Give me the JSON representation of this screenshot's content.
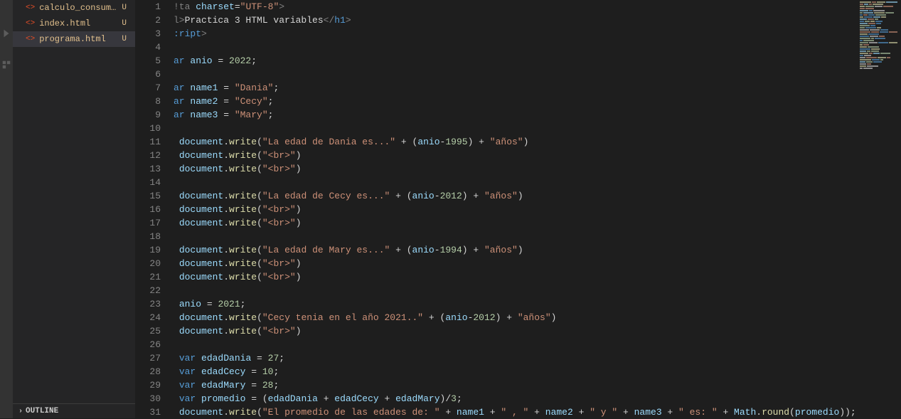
{
  "sidebar": {
    "files": [
      {
        "name": "calculo_consum…",
        "status": "U",
        "active": false
      },
      {
        "name": "index.html",
        "status": "U",
        "active": false
      },
      {
        "name": "programa.html",
        "status": "U",
        "active": true
      }
    ],
    "outline_label": "OUTLINE"
  },
  "editor": {
    "lines": [
      {
        "num": "1",
        "tokens": [
          {
            "t": "!ta ",
            "c": "c-tag"
          },
          {
            "t": "charset",
            "c": "c-var"
          },
          {
            "t": "=",
            "c": "c-op"
          },
          {
            "t": "\"UTF-8\"",
            "c": "c-str"
          },
          {
            "t": ">",
            "c": "c-tag"
          }
        ]
      },
      {
        "num": "2",
        "tokens": [
          {
            "t": "l>",
            "c": "c-tag"
          },
          {
            "t": "Practica 3 HTML variables",
            "c": "c-text"
          },
          {
            "t": "</",
            "c": "c-tag"
          },
          {
            "t": "h1",
            "c": "c-kw"
          },
          {
            "t": ">",
            "c": "c-tag"
          }
        ]
      },
      {
        "num": "3",
        "tokens": [
          {
            "t": ":ript",
            "c": "c-kw"
          },
          {
            "t": ">",
            "c": "c-tag"
          }
        ]
      },
      {
        "num": "4",
        "tokens": []
      },
      {
        "num": "5",
        "tokens": [
          {
            "t": "ar ",
            "c": "c-kw"
          },
          {
            "t": "anio",
            "c": "c-var"
          },
          {
            "t": " = ",
            "c": "c-op"
          },
          {
            "t": "2022",
            "c": "c-num"
          },
          {
            "t": ";",
            "c": "c-punc"
          }
        ]
      },
      {
        "num": "6",
        "tokens": []
      },
      {
        "num": "7",
        "tokens": [
          {
            "t": "ar ",
            "c": "c-kw"
          },
          {
            "t": "name1",
            "c": "c-var"
          },
          {
            "t": " = ",
            "c": "c-op"
          },
          {
            "t": "\"Dania\"",
            "c": "c-str"
          },
          {
            "t": ";",
            "c": "c-punc"
          }
        ]
      },
      {
        "num": "8",
        "tokens": [
          {
            "t": "ar ",
            "c": "c-kw"
          },
          {
            "t": "name2",
            "c": "c-var"
          },
          {
            "t": " = ",
            "c": "c-op"
          },
          {
            "t": "\"Cecy\"",
            "c": "c-str"
          },
          {
            "t": ";",
            "c": "c-punc"
          }
        ]
      },
      {
        "num": "9",
        "tokens": [
          {
            "t": "ar ",
            "c": "c-kw"
          },
          {
            "t": "name3",
            "c": "c-var"
          },
          {
            "t": " = ",
            "c": "c-op"
          },
          {
            "t": "\"Mary\"",
            "c": "c-str"
          },
          {
            "t": ";",
            "c": "c-punc"
          }
        ]
      },
      {
        "num": "10",
        "tokens": []
      },
      {
        "num": "11",
        "tokens": [
          {
            "t": " ",
            "c": "c-text"
          },
          {
            "t": "document",
            "c": "c-obj"
          },
          {
            "t": ".",
            "c": "c-punc"
          },
          {
            "t": "write",
            "c": "c-fn"
          },
          {
            "t": "(",
            "c": "c-punc"
          },
          {
            "t": "\"La edad de Dania es...\"",
            "c": "c-str"
          },
          {
            "t": " + (",
            "c": "c-op"
          },
          {
            "t": "anio",
            "c": "c-var"
          },
          {
            "t": "-",
            "c": "c-op"
          },
          {
            "t": "1995",
            "c": "c-num"
          },
          {
            "t": ") + ",
            "c": "c-op"
          },
          {
            "t": "\"años\"",
            "c": "c-str"
          },
          {
            "t": ")",
            "c": "c-punc"
          }
        ]
      },
      {
        "num": "12",
        "tokens": [
          {
            "t": " ",
            "c": "c-text"
          },
          {
            "t": "document",
            "c": "c-obj"
          },
          {
            "t": ".",
            "c": "c-punc"
          },
          {
            "t": "write",
            "c": "c-fn"
          },
          {
            "t": "(",
            "c": "c-punc"
          },
          {
            "t": "\"<br>\"",
            "c": "c-str"
          },
          {
            "t": ")",
            "c": "c-punc"
          }
        ]
      },
      {
        "num": "13",
        "tokens": [
          {
            "t": " ",
            "c": "c-text"
          },
          {
            "t": "document",
            "c": "c-obj"
          },
          {
            "t": ".",
            "c": "c-punc"
          },
          {
            "t": "write",
            "c": "c-fn"
          },
          {
            "t": "(",
            "c": "c-punc"
          },
          {
            "t": "\"<br>\"",
            "c": "c-str"
          },
          {
            "t": ")",
            "c": "c-punc"
          }
        ]
      },
      {
        "num": "14",
        "tokens": []
      },
      {
        "num": "15",
        "tokens": [
          {
            "t": " ",
            "c": "c-text"
          },
          {
            "t": "document",
            "c": "c-obj"
          },
          {
            "t": ".",
            "c": "c-punc"
          },
          {
            "t": "write",
            "c": "c-fn"
          },
          {
            "t": "(",
            "c": "c-punc"
          },
          {
            "t": "\"La edad de Cecy es...\"",
            "c": "c-str"
          },
          {
            "t": " + (",
            "c": "c-op"
          },
          {
            "t": "anio",
            "c": "c-var"
          },
          {
            "t": "-",
            "c": "c-op"
          },
          {
            "t": "2012",
            "c": "c-num"
          },
          {
            "t": ") + ",
            "c": "c-op"
          },
          {
            "t": "\"años\"",
            "c": "c-str"
          },
          {
            "t": ")",
            "c": "c-punc"
          }
        ]
      },
      {
        "num": "16",
        "tokens": [
          {
            "t": " ",
            "c": "c-text"
          },
          {
            "t": "document",
            "c": "c-obj"
          },
          {
            "t": ".",
            "c": "c-punc"
          },
          {
            "t": "write",
            "c": "c-fn"
          },
          {
            "t": "(",
            "c": "c-punc"
          },
          {
            "t": "\"<br>\"",
            "c": "c-str"
          },
          {
            "t": ")",
            "c": "c-punc"
          }
        ]
      },
      {
        "num": "17",
        "tokens": [
          {
            "t": " ",
            "c": "c-text"
          },
          {
            "t": "document",
            "c": "c-obj"
          },
          {
            "t": ".",
            "c": "c-punc"
          },
          {
            "t": "write",
            "c": "c-fn"
          },
          {
            "t": "(",
            "c": "c-punc"
          },
          {
            "t": "\"<br>\"",
            "c": "c-str"
          },
          {
            "t": ")",
            "c": "c-punc"
          }
        ]
      },
      {
        "num": "18",
        "tokens": []
      },
      {
        "num": "19",
        "tokens": [
          {
            "t": " ",
            "c": "c-text"
          },
          {
            "t": "document",
            "c": "c-obj"
          },
          {
            "t": ".",
            "c": "c-punc"
          },
          {
            "t": "write",
            "c": "c-fn"
          },
          {
            "t": "(",
            "c": "c-punc"
          },
          {
            "t": "\"La edad de Mary es...\"",
            "c": "c-str"
          },
          {
            "t": " + (",
            "c": "c-op"
          },
          {
            "t": "anio",
            "c": "c-var"
          },
          {
            "t": "-",
            "c": "c-op"
          },
          {
            "t": "1994",
            "c": "c-num"
          },
          {
            "t": ") + ",
            "c": "c-op"
          },
          {
            "t": "\"años\"",
            "c": "c-str"
          },
          {
            "t": ")",
            "c": "c-punc"
          }
        ]
      },
      {
        "num": "20",
        "tokens": [
          {
            "t": " ",
            "c": "c-text"
          },
          {
            "t": "document",
            "c": "c-obj"
          },
          {
            "t": ".",
            "c": "c-punc"
          },
          {
            "t": "write",
            "c": "c-fn"
          },
          {
            "t": "(",
            "c": "c-punc"
          },
          {
            "t": "\"<br>\"",
            "c": "c-str"
          },
          {
            "t": ")",
            "c": "c-punc"
          }
        ]
      },
      {
        "num": "21",
        "tokens": [
          {
            "t": " ",
            "c": "c-text"
          },
          {
            "t": "document",
            "c": "c-obj"
          },
          {
            "t": ".",
            "c": "c-punc"
          },
          {
            "t": "write",
            "c": "c-fn"
          },
          {
            "t": "(",
            "c": "c-punc"
          },
          {
            "t": "\"<br>\"",
            "c": "c-str"
          },
          {
            "t": ")",
            "c": "c-punc"
          }
        ]
      },
      {
        "num": "22",
        "tokens": []
      },
      {
        "num": "23",
        "tokens": [
          {
            "t": " ",
            "c": "c-text"
          },
          {
            "t": "anio",
            "c": "c-var"
          },
          {
            "t": " = ",
            "c": "c-op"
          },
          {
            "t": "2021",
            "c": "c-num"
          },
          {
            "t": ";",
            "c": "c-punc"
          }
        ]
      },
      {
        "num": "24",
        "tokens": [
          {
            "t": " ",
            "c": "c-text"
          },
          {
            "t": "document",
            "c": "c-obj"
          },
          {
            "t": ".",
            "c": "c-punc"
          },
          {
            "t": "write",
            "c": "c-fn"
          },
          {
            "t": "(",
            "c": "c-punc"
          },
          {
            "t": "\"Cecy tenia en el año 2021..\"",
            "c": "c-str"
          },
          {
            "t": " + (",
            "c": "c-op"
          },
          {
            "t": "anio",
            "c": "c-var"
          },
          {
            "t": "-",
            "c": "c-op"
          },
          {
            "t": "2012",
            "c": "c-num"
          },
          {
            "t": ") + ",
            "c": "c-op"
          },
          {
            "t": "\"años\"",
            "c": "c-str"
          },
          {
            "t": ")",
            "c": "c-punc"
          }
        ]
      },
      {
        "num": "25",
        "tokens": [
          {
            "t": " ",
            "c": "c-text"
          },
          {
            "t": "document",
            "c": "c-obj"
          },
          {
            "t": ".",
            "c": "c-punc"
          },
          {
            "t": "write",
            "c": "c-fn"
          },
          {
            "t": "(",
            "c": "c-punc"
          },
          {
            "t": "\"<br>\"",
            "c": "c-str"
          },
          {
            "t": ")",
            "c": "c-punc"
          }
        ]
      },
      {
        "num": "26",
        "tokens": []
      },
      {
        "num": "27",
        "tokens": [
          {
            "t": " ",
            "c": "c-text"
          },
          {
            "t": "var ",
            "c": "c-kw"
          },
          {
            "t": "edadDania",
            "c": "c-var"
          },
          {
            "t": " = ",
            "c": "c-op"
          },
          {
            "t": "27",
            "c": "c-num"
          },
          {
            "t": ";",
            "c": "c-punc"
          }
        ]
      },
      {
        "num": "28",
        "tokens": [
          {
            "t": " ",
            "c": "c-text"
          },
          {
            "t": "var ",
            "c": "c-kw"
          },
          {
            "t": "edadCecy",
            "c": "c-var"
          },
          {
            "t": " = ",
            "c": "c-op"
          },
          {
            "t": "10",
            "c": "c-num"
          },
          {
            "t": ";",
            "c": "c-punc"
          }
        ]
      },
      {
        "num": "29",
        "tokens": [
          {
            "t": " ",
            "c": "c-text"
          },
          {
            "t": "var ",
            "c": "c-kw"
          },
          {
            "t": "edadMary",
            "c": "c-var"
          },
          {
            "t": " = ",
            "c": "c-op"
          },
          {
            "t": "28",
            "c": "c-num"
          },
          {
            "t": ";",
            "c": "c-punc"
          }
        ]
      },
      {
        "num": "30",
        "tokens": [
          {
            "t": " ",
            "c": "c-text"
          },
          {
            "t": "var ",
            "c": "c-kw"
          },
          {
            "t": "promedio",
            "c": "c-var"
          },
          {
            "t": " = (",
            "c": "c-op"
          },
          {
            "t": "edadDania",
            "c": "c-var"
          },
          {
            "t": " + ",
            "c": "c-op"
          },
          {
            "t": "edadCecy",
            "c": "c-var"
          },
          {
            "t": " + ",
            "c": "c-op"
          },
          {
            "t": "edadMary",
            "c": "c-var"
          },
          {
            "t": ")/",
            "c": "c-op"
          },
          {
            "t": "3",
            "c": "c-num"
          },
          {
            "t": ";",
            "c": "c-punc"
          }
        ]
      },
      {
        "num": "31",
        "tokens": [
          {
            "t": " ",
            "c": "c-text"
          },
          {
            "t": "document",
            "c": "c-obj"
          },
          {
            "t": ".",
            "c": "c-punc"
          },
          {
            "t": "write",
            "c": "c-fn"
          },
          {
            "t": "(",
            "c": "c-punc"
          },
          {
            "t": "\"El promedio de las edades de: \"",
            "c": "c-str"
          },
          {
            "t": " + ",
            "c": "c-op"
          },
          {
            "t": "name1",
            "c": "c-var"
          },
          {
            "t": " + ",
            "c": "c-op"
          },
          {
            "t": "\" , \"",
            "c": "c-str"
          },
          {
            "t": " + ",
            "c": "c-op"
          },
          {
            "t": "name2",
            "c": "c-var"
          },
          {
            "t": " + ",
            "c": "c-op"
          },
          {
            "t": "\" y \"",
            "c": "c-str"
          },
          {
            "t": " + ",
            "c": "c-op"
          },
          {
            "t": "name3",
            "c": "c-var"
          },
          {
            "t": " + ",
            "c": "c-op"
          },
          {
            "t": "\" es: \"",
            "c": "c-str"
          },
          {
            "t": " + ",
            "c": "c-op"
          },
          {
            "t": "Math",
            "c": "c-obj"
          },
          {
            "t": ".",
            "c": "c-punc"
          },
          {
            "t": "round",
            "c": "c-fn"
          },
          {
            "t": "(",
            "c": "c-punc"
          },
          {
            "t": "promedio",
            "c": "c-var"
          },
          {
            "t": "));",
            "c": "c-punc"
          }
        ]
      }
    ]
  }
}
